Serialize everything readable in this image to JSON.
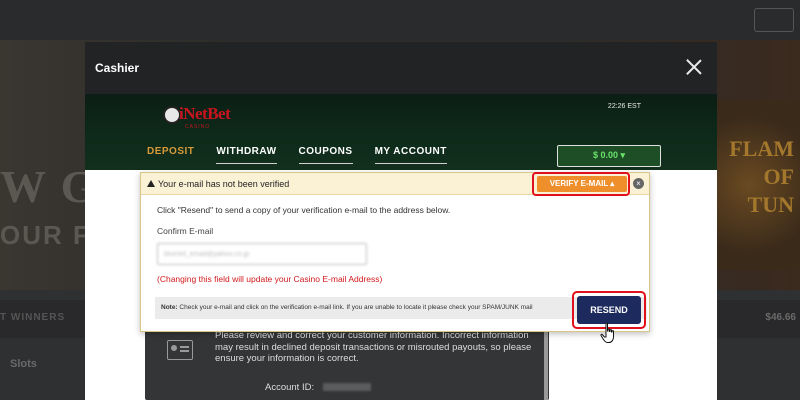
{
  "background": {
    "top_button": "",
    "banner_text_1": "W G",
    "banner_text_2": "OUR FR",
    "right_banner": "FLAM\nOF\nTUN",
    "winners_label": "T WINNERS",
    "winners_amount": "$46.66",
    "slots_label": "Slots"
  },
  "modal": {
    "title": "Cashier",
    "clock": "22:26 EST",
    "logo_text": "iNetBet",
    "logo_sub": "CASINO",
    "tabs": [
      {
        "label": "DEPOSIT",
        "active": true
      },
      {
        "label": "WITHDRAW",
        "active": false
      },
      {
        "label": "COUPONS",
        "active": false
      },
      {
        "label": "MY ACCOUNT",
        "active": false
      }
    ],
    "balance": "$ 0.00 ▾"
  },
  "popup": {
    "warning": "Your e-mail has not been verified",
    "verify_button": "VERIFY E-MAIL ▴",
    "close_glyph": "×",
    "instruction": "Click \"Resend\" to send a copy of your verification e-mail to the address below.",
    "confirm_label": "Confirm E-mail",
    "email_value": "blurred_email@yahoo.co.jp",
    "change_warning": "(Changing this field will update your Casino E-mail Address)",
    "note_bold": "Note:",
    "note_text": " Check your e-mail and click on the verification e-mail link. If you are unable to locate it please check your SPAM/JUNK mail",
    "resend_button": "RESEND"
  },
  "info": {
    "text": "Please review and correct your customer information. Incorrect information may result in declined deposit transactions or misrouted payouts, so please ensure your information is correct.",
    "account_id_label": "Account ID:"
  },
  "colors": {
    "accent_orange": "#ef8f2b",
    "resend_navy": "#1c2a5e",
    "highlight_red": "#e0101d",
    "balance_green": "#6be36b"
  }
}
